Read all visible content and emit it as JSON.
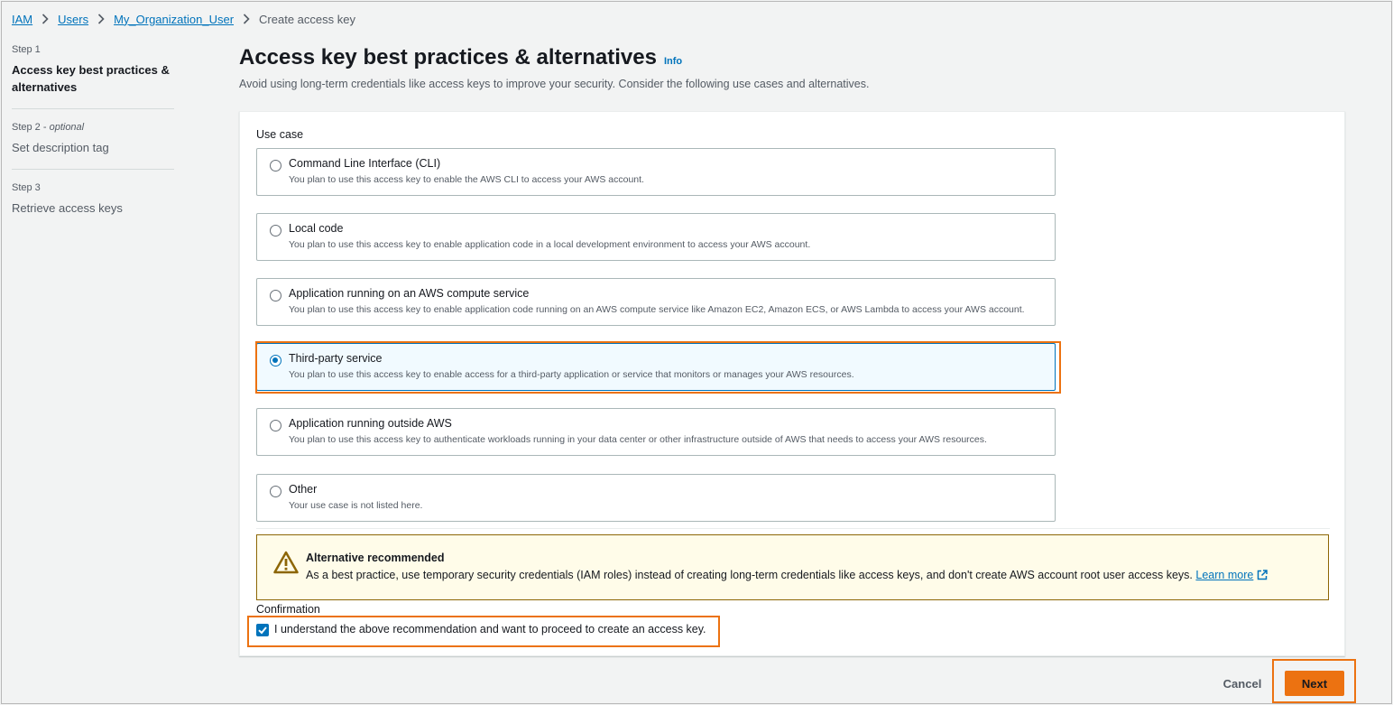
{
  "breadcrumb": {
    "items": [
      "IAM",
      "Users",
      "My_Organization_User"
    ],
    "current": "Create access key"
  },
  "steps": [
    {
      "num": "Step 1",
      "optional": "",
      "title": "Access key best practices & alternatives"
    },
    {
      "num": "Step 2 - ",
      "optional": "optional",
      "title": "Set description tag"
    },
    {
      "num": "Step 3",
      "optional": "",
      "title": "Retrieve access keys"
    }
  ],
  "header": {
    "title": "Access key best practices & alternatives",
    "info": "Info",
    "description": "Avoid using long-term credentials like access keys to improve your security. Consider the following use cases and alternatives."
  },
  "use_case": {
    "label": "Use case",
    "selected": "Third-party service",
    "options": [
      {
        "label": "Command Line Interface (CLI)",
        "desc": "You plan to use this access key to enable the AWS CLI to access your AWS account."
      },
      {
        "label": "Local code",
        "desc": "You plan to use this access key to enable application code in a local development environment to access your AWS account."
      },
      {
        "label": "Application running on an AWS compute service",
        "desc": "You plan to use this access key to enable application code running on an AWS compute service like Amazon EC2, Amazon ECS, or AWS Lambda to access your AWS account."
      },
      {
        "label": "Third-party service",
        "desc": "You plan to use this access key to enable access for a third-party application or service that monitors or manages your AWS resources."
      },
      {
        "label": "Application running outside AWS",
        "desc": "You plan to use this access key to authenticate workloads running in your data center or other infrastructure outside of AWS that needs to access your AWS resources."
      },
      {
        "label": "Other",
        "desc": "Your use case is not listed here."
      }
    ]
  },
  "alert": {
    "icon": "warning-icon",
    "title": "Alternative recommended",
    "body": "As a best practice, use temporary security credentials (IAM roles) instead of creating long-term credentials like access keys, and don't create AWS account root user access keys.",
    "link": "Learn more"
  },
  "confirmation": {
    "label": "Confirmation",
    "checkbox_text": "I understand the above recommendation and want to proceed to create an access key.",
    "checked": true
  },
  "footer": {
    "cancel": "Cancel",
    "next": "Next"
  },
  "colors": {
    "link": "#0073bb",
    "primary": "#ec7211",
    "highlight": "#ec7211",
    "warning_bg": "#fffce9"
  }
}
